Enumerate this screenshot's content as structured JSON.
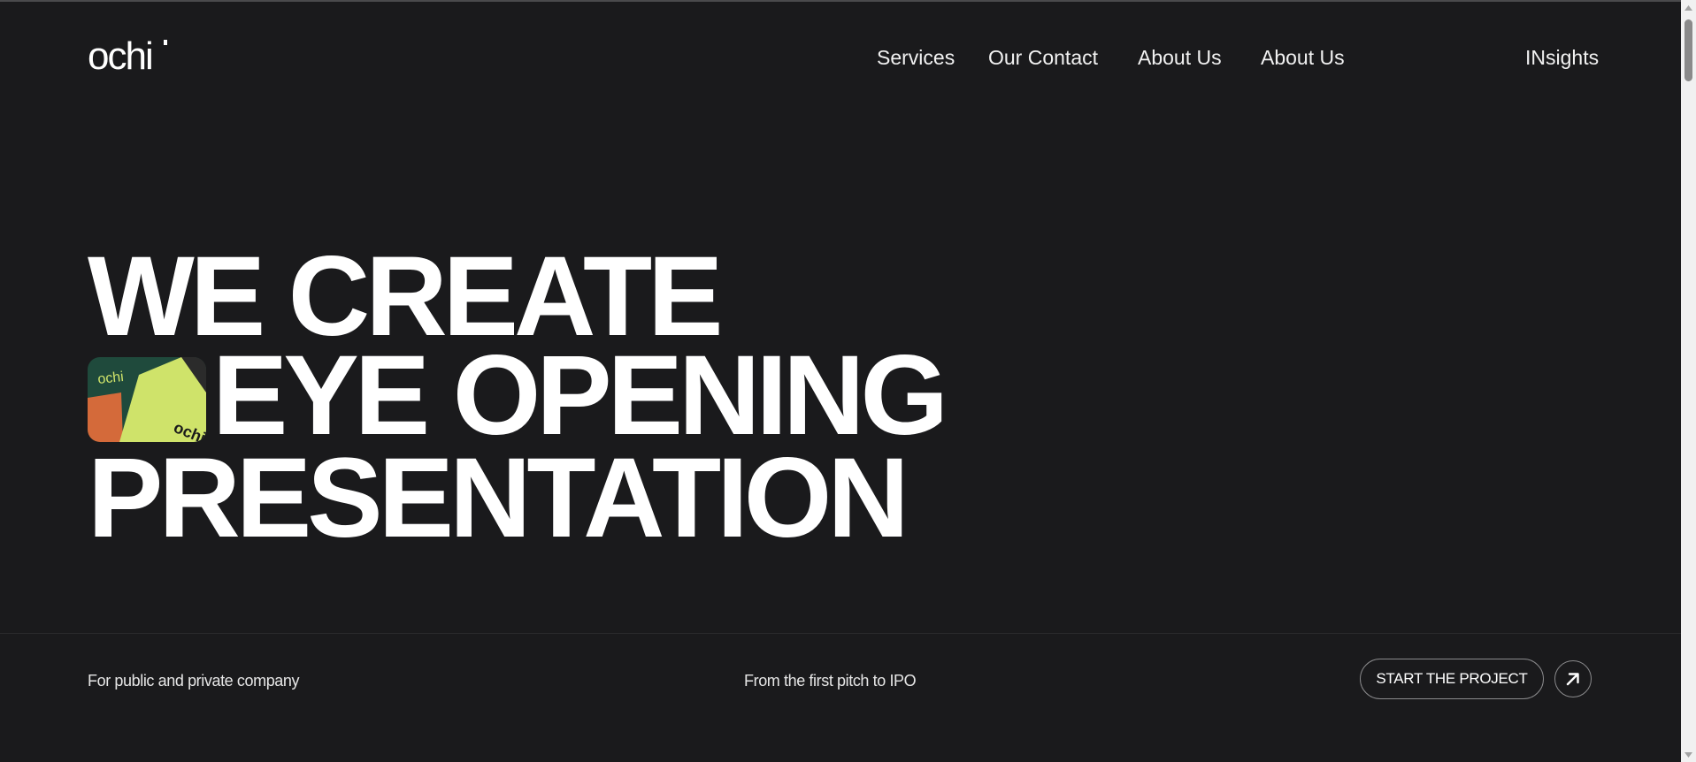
{
  "brand": {
    "logo_text": "ochi"
  },
  "nav": {
    "items": [
      {
        "label": "Services"
      },
      {
        "label": "Our Contact"
      },
      {
        "label": "About Us"
      },
      {
        "label": "About Us"
      }
    ],
    "insights_label": "INsights"
  },
  "hero": {
    "line1": "WE CREATE",
    "line2": "EYE OPENING",
    "line3": "PRESENTATION",
    "thumb_logo_top": "ochi",
    "thumb_logo_bottom": "ochi"
  },
  "footer_bar": {
    "left_text": "For public and private company",
    "center_text": "From the first pitch to IPO",
    "cta_label": "START THE PROJECT"
  },
  "icons": {
    "cta": "arrow-up-right-icon",
    "scroll_up": "triangle-up-icon",
    "scroll_down": "triangle-down-icon"
  },
  "colors": {
    "background": "#1a1a1c",
    "text": "#ffffff",
    "thumb_dark": "#1f4a3c",
    "thumb_lime": "#cfe36a",
    "thumb_orange": "#d46a3a"
  }
}
